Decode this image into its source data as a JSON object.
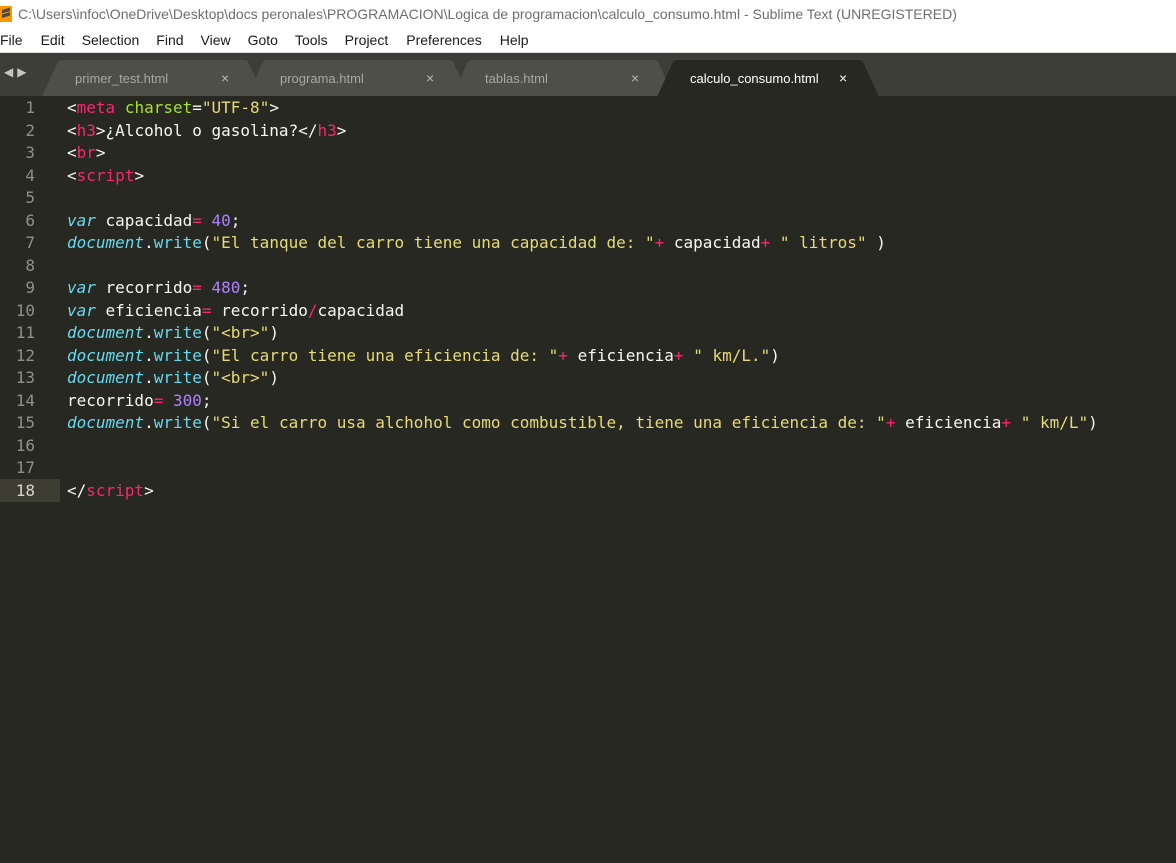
{
  "window": {
    "title": "C:\\Users\\infoc\\OneDrive\\Desktop\\docs peronales\\PROGRAMACION\\Logica de programacion\\calculo_consumo.html - Sublime Text (UNREGISTERED)"
  },
  "menu": [
    "File",
    "Edit",
    "Selection",
    "Find",
    "View",
    "Goto",
    "Tools",
    "Project",
    "Preferences",
    "Help"
  ],
  "tabs": [
    {
      "label": "primer_test.html",
      "active": false
    },
    {
      "label": "programa.html",
      "active": false
    },
    {
      "label": "tablas.html",
      "active": false
    },
    {
      "label": "calculo_consumo.html",
      "active": true
    }
  ],
  "close_glyph": "×",
  "nav_arrows": "◀▶",
  "editor": {
    "current_line": 18,
    "lines": [
      {
        "n": "1",
        "tokens": [
          {
            "t": "<",
            "c": "t-txt"
          },
          {
            "t": "meta",
            "c": "t-tag"
          },
          {
            "t": " ",
            "c": "t-txt"
          },
          {
            "t": "charset",
            "c": "t-attr"
          },
          {
            "t": "=",
            "c": "t-txt"
          },
          {
            "t": "\"UTF-8\"",
            "c": "t-str"
          },
          {
            "t": ">",
            "c": "t-txt"
          }
        ]
      },
      {
        "n": "2",
        "tokens": [
          {
            "t": "<",
            "c": "t-txt"
          },
          {
            "t": "h3",
            "c": "t-tag"
          },
          {
            "t": ">¿Alcohol o gasolina?</",
            "c": "t-txt"
          },
          {
            "t": "h3",
            "c": "t-tag"
          },
          {
            "t": ">",
            "c": "t-txt"
          }
        ]
      },
      {
        "n": "3",
        "tokens": [
          {
            "t": "<",
            "c": "t-txt"
          },
          {
            "t": "br",
            "c": "t-tag"
          },
          {
            "t": ">",
            "c": "t-txt"
          }
        ]
      },
      {
        "n": "4",
        "tokens": [
          {
            "t": "<",
            "c": "t-txt"
          },
          {
            "t": "script",
            "c": "t-tag"
          },
          {
            "t": ">",
            "c": "t-txt"
          }
        ]
      },
      {
        "n": "5",
        "tokens": []
      },
      {
        "n": "6",
        "tokens": [
          {
            "t": "var",
            "c": "t-kw"
          },
          {
            "t": " capacidad",
            "c": "t-txt"
          },
          {
            "t": "=",
            "c": "t-op"
          },
          {
            "t": " ",
            "c": "t-txt"
          },
          {
            "t": "40",
            "c": "t-num"
          },
          {
            "t": ";",
            "c": "t-txt"
          }
        ]
      },
      {
        "n": "7",
        "tokens": [
          {
            "t": "document",
            "c": "t-obj"
          },
          {
            "t": ".",
            "c": "t-txt"
          },
          {
            "t": "write",
            "c": "t-fn"
          },
          {
            "t": "(",
            "c": "t-txt"
          },
          {
            "t": "\"El tanque del carro tiene una capacidad de: \"",
            "c": "t-str"
          },
          {
            "t": "+",
            "c": "t-op"
          },
          {
            "t": " capacidad",
            "c": "t-txt"
          },
          {
            "t": "+",
            "c": "t-op"
          },
          {
            "t": " ",
            "c": "t-txt"
          },
          {
            "t": "\" litros\"",
            "c": "t-str"
          },
          {
            "t": " )",
            "c": "t-txt"
          }
        ]
      },
      {
        "n": "8",
        "tokens": []
      },
      {
        "n": "9",
        "tokens": [
          {
            "t": "var",
            "c": "t-kw"
          },
          {
            "t": " recorrido",
            "c": "t-txt"
          },
          {
            "t": "=",
            "c": "t-op"
          },
          {
            "t": " ",
            "c": "t-txt"
          },
          {
            "t": "480",
            "c": "t-num"
          },
          {
            "t": ";",
            "c": "t-txt"
          }
        ]
      },
      {
        "n": "10",
        "tokens": [
          {
            "t": "var",
            "c": "t-kw"
          },
          {
            "t": " eficiencia",
            "c": "t-txt"
          },
          {
            "t": "=",
            "c": "t-op"
          },
          {
            "t": " recorrido",
            "c": "t-txt"
          },
          {
            "t": "/",
            "c": "t-op"
          },
          {
            "t": "capacidad",
            "c": "t-txt"
          }
        ]
      },
      {
        "n": "11",
        "tokens": [
          {
            "t": "document",
            "c": "t-obj"
          },
          {
            "t": ".",
            "c": "t-txt"
          },
          {
            "t": "write",
            "c": "t-fn"
          },
          {
            "t": "(",
            "c": "t-txt"
          },
          {
            "t": "\"<br>\"",
            "c": "t-str"
          },
          {
            "t": ")",
            "c": "t-txt"
          }
        ]
      },
      {
        "n": "12",
        "tokens": [
          {
            "t": "document",
            "c": "t-obj"
          },
          {
            "t": ".",
            "c": "t-txt"
          },
          {
            "t": "write",
            "c": "t-fn"
          },
          {
            "t": "(",
            "c": "t-txt"
          },
          {
            "t": "\"El carro tiene una eficiencia de: \"",
            "c": "t-str"
          },
          {
            "t": "+",
            "c": "t-op"
          },
          {
            "t": " eficiencia",
            "c": "t-txt"
          },
          {
            "t": "+",
            "c": "t-op"
          },
          {
            "t": " ",
            "c": "t-txt"
          },
          {
            "t": "\" km/L.\"",
            "c": "t-str"
          },
          {
            "t": ")",
            "c": "t-txt"
          }
        ]
      },
      {
        "n": "13",
        "tokens": [
          {
            "t": "document",
            "c": "t-obj"
          },
          {
            "t": ".",
            "c": "t-txt"
          },
          {
            "t": "write",
            "c": "t-fn"
          },
          {
            "t": "(",
            "c": "t-txt"
          },
          {
            "t": "\"<br>\"",
            "c": "t-str"
          },
          {
            "t": ")",
            "c": "t-txt"
          }
        ]
      },
      {
        "n": "14",
        "tokens": [
          {
            "t": "recorrido",
            "c": "t-txt"
          },
          {
            "t": "=",
            "c": "t-op"
          },
          {
            "t": " ",
            "c": "t-txt"
          },
          {
            "t": "300",
            "c": "t-num"
          },
          {
            "t": ";",
            "c": "t-txt"
          }
        ]
      },
      {
        "n": "15",
        "tokens": [
          {
            "t": "document",
            "c": "t-obj"
          },
          {
            "t": ".",
            "c": "t-txt"
          },
          {
            "t": "write",
            "c": "t-fn"
          },
          {
            "t": "(",
            "c": "t-txt"
          },
          {
            "t": "\"Si el carro usa alchohol como combustible, tiene una eficiencia de: \"",
            "c": "t-str"
          },
          {
            "t": "+",
            "c": "t-op"
          },
          {
            "t": " eficiencia",
            "c": "t-txt"
          },
          {
            "t": "+",
            "c": "t-op"
          },
          {
            "t": " ",
            "c": "t-txt"
          },
          {
            "t": "\" km/L\"",
            "c": "t-str"
          },
          {
            "t": ")",
            "c": "t-txt"
          }
        ]
      },
      {
        "n": "16",
        "tokens": []
      },
      {
        "n": "17",
        "tokens": []
      },
      {
        "n": "18",
        "tokens": [
          {
            "t": "</",
            "c": "t-txt"
          },
          {
            "t": "script",
            "c": "t-tag"
          },
          {
            "t": ">",
            "c": "t-txt"
          }
        ]
      }
    ]
  },
  "colors": {
    "editor_bg": "#272822",
    "tabbar_bg": "#3d3e38",
    "tab_inactive": "#4e4f47",
    "tab_active": "#272822",
    "tag": "#f92672",
    "attr": "#a6e22e",
    "string": "#e6db74",
    "keyword": "#66d9ef",
    "number": "#ae81ff",
    "text": "#f8f8f2",
    "line_number": "#90908a"
  }
}
